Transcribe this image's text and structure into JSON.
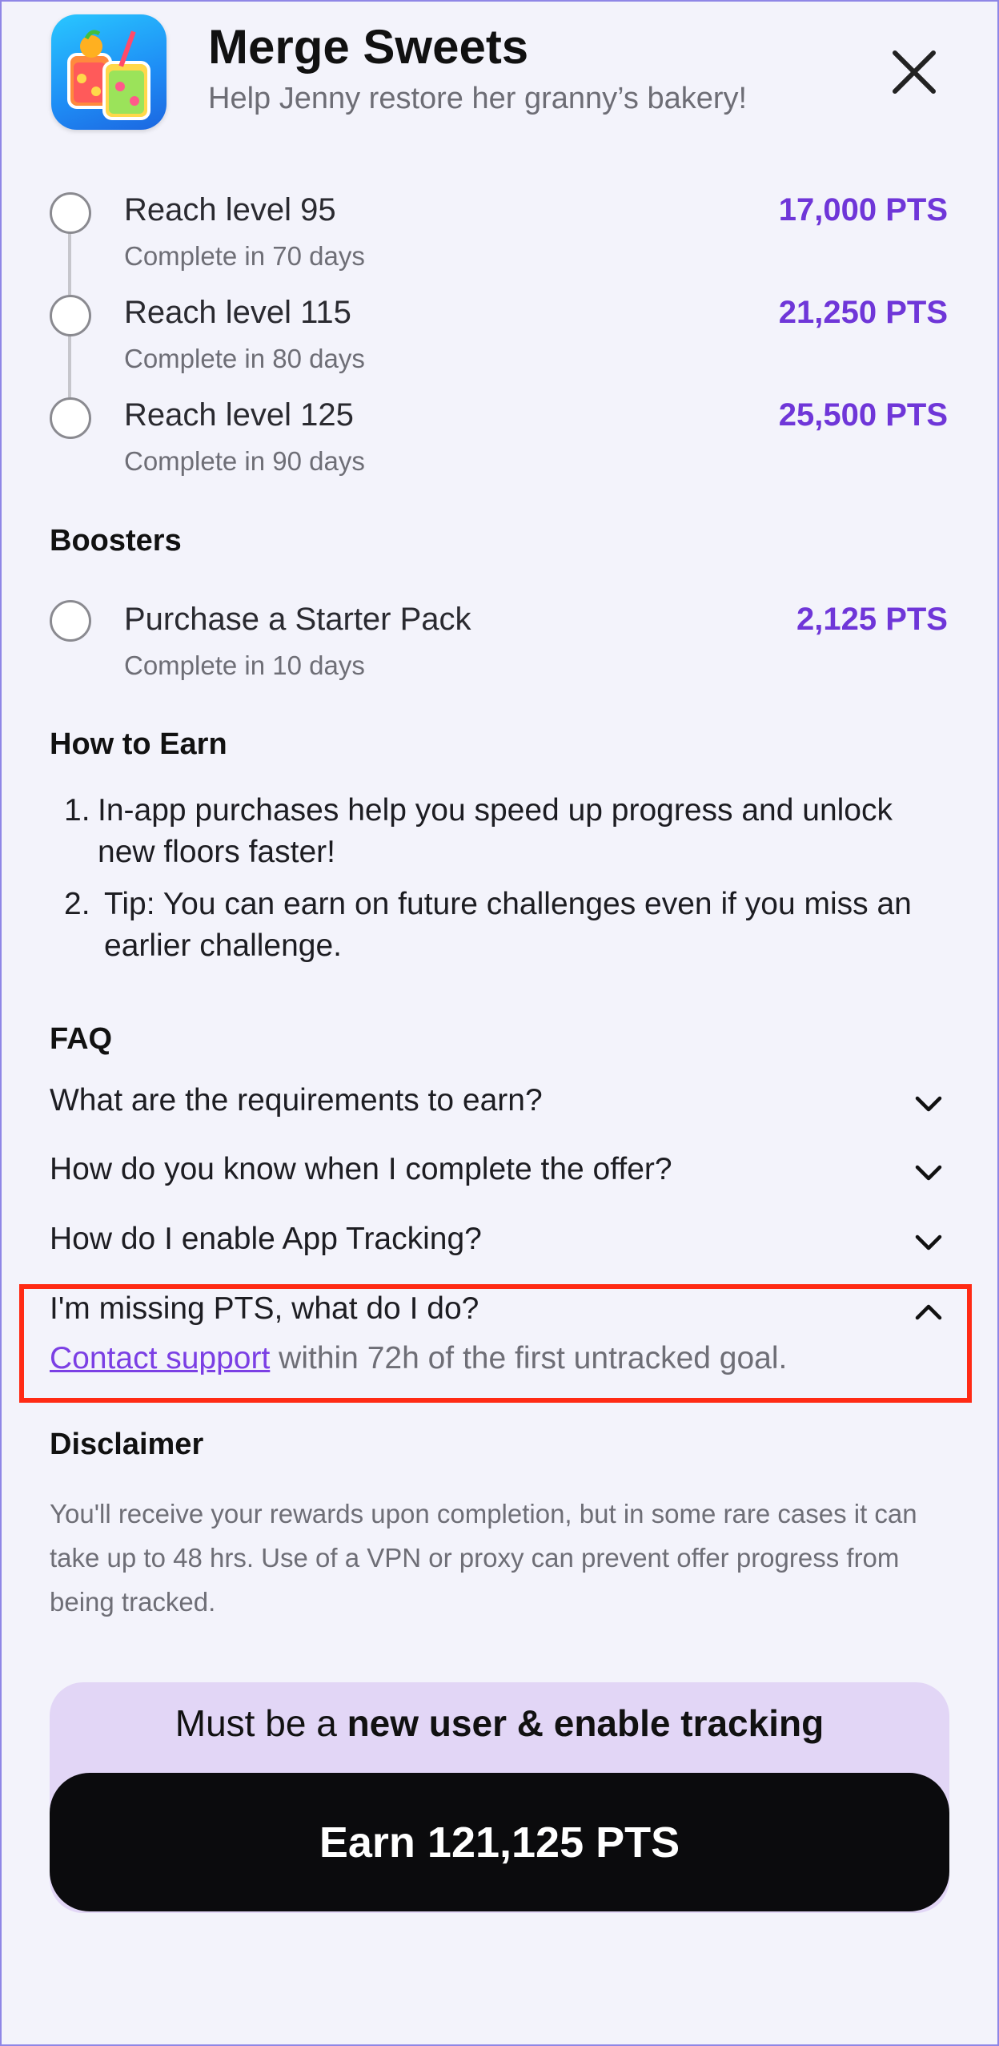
{
  "app": {
    "title": "Merge Sweets",
    "subtitle": "Help Jenny restore her granny’s bakery!",
    "icon": "juice-jars-app-icon"
  },
  "goals": [
    {
      "title": "Reach level 95",
      "sub": "Complete in 70 days",
      "pts": "17,000 PTS"
    },
    {
      "title": "Reach level 115",
      "sub": "Complete in 80 days",
      "pts": "21,250 PTS"
    },
    {
      "title": "Reach level 125",
      "sub": "Complete in 90 days",
      "pts": "25,500 PTS"
    }
  ],
  "boosters": {
    "heading": "Boosters",
    "items": [
      {
        "title": "Purchase a Starter Pack",
        "sub": "Complete in 10 days",
        "pts": "2,125 PTS"
      }
    ]
  },
  "how_to_earn": {
    "heading": "How to Earn",
    "items": [
      {
        "num": "1.",
        "line1": "In-app purchases help you speed up progress and unlock",
        "line2": "new floors faster!"
      },
      {
        "num": "2.",
        "line1": "Tip: You can earn on future challenges even if you miss an",
        "line2": "earlier challenge."
      }
    ]
  },
  "faq": {
    "heading": "FAQ",
    "items": [
      {
        "q": "What are the requirements to earn?"
      },
      {
        "q": "How do you know when I complete the offer?"
      },
      {
        "q": "How do I enable App Tracking?"
      },
      {
        "q": "I'm missing PTS, what do I do?",
        "answer_link": "Contact support",
        "answer_rest": " within 72h of the first untracked goal."
      }
    ]
  },
  "disclaimer": {
    "heading": "Disclaimer",
    "line1": "You'll receive your rewards upon completion, but in some rare cases it can",
    "line2": "take up to 48 hrs. Use of a VPN or proxy can prevent offer progress from",
    "line3": "being tracked."
  },
  "requirement": {
    "prefix": "Must be a ",
    "bold": "new user & enable tracking"
  },
  "cta": {
    "label": "Earn 121,125 PTS"
  },
  "colors": {
    "accent": "#6f36d8",
    "highlight": "#ff2a14",
    "banner": "#e2d6f6",
    "cta_bg": "#0b0b0d"
  }
}
